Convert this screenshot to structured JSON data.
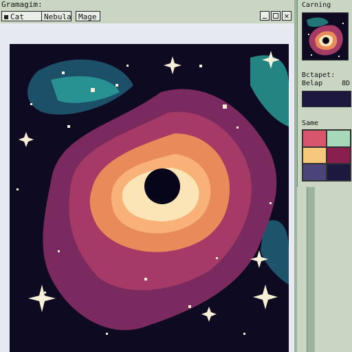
{
  "window": {
    "title": "Gramagim:"
  },
  "tabs": [
    {
      "label": "Cat Eye"
    },
    {
      "label": "Nebula"
    },
    {
      "label": "Mage"
    }
  ],
  "side_panel": {
    "preview_label": "Carning",
    "section_label": "Bctapet:",
    "sub_label_left": "Belap",
    "sub_label_right": "8D",
    "palette_label": "Same",
    "palette_colors": [
      "#d7566b",
      "#a6d9b9",
      "#f5c87c",
      "#8a1f4e",
      "#4a4478",
      "#1c1840"
    ]
  },
  "colors": {
    "space": "#0e0a22",
    "nebula_purple": "#7a2a5e",
    "nebula_magenta": "#a63a66",
    "nebula_orange": "#e88a5a",
    "nebula_glow": "#fbe4b6",
    "teal": "#2aa39b",
    "star": "#f7f0d6"
  }
}
